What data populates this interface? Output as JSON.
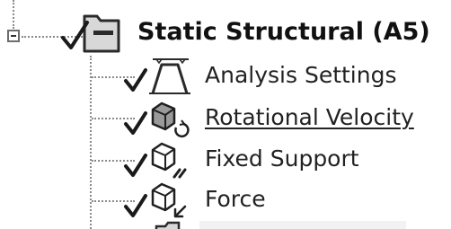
{
  "tree": {
    "root": {
      "label": "Static Structural (A5)",
      "icon": "folder-icon",
      "expanded": true
    },
    "children": [
      {
        "label": "Analysis Settings",
        "icon": "analysis-settings-icon",
        "status": "check"
      },
      {
        "label": "Rotational Velocity",
        "icon": "rotational-velocity-icon",
        "status": "check",
        "hovered": true
      },
      {
        "label": "Fixed Support",
        "icon": "fixed-support-icon",
        "status": "check"
      },
      {
        "label": "Force",
        "icon": "force-icon",
        "status": "check"
      }
    ]
  },
  "colors": {
    "check": "#1a1a1a",
    "icon_stroke": "#2a2a2a",
    "folder_fill": "#d8d8d8",
    "dotted_line": "#8a8a8a"
  }
}
